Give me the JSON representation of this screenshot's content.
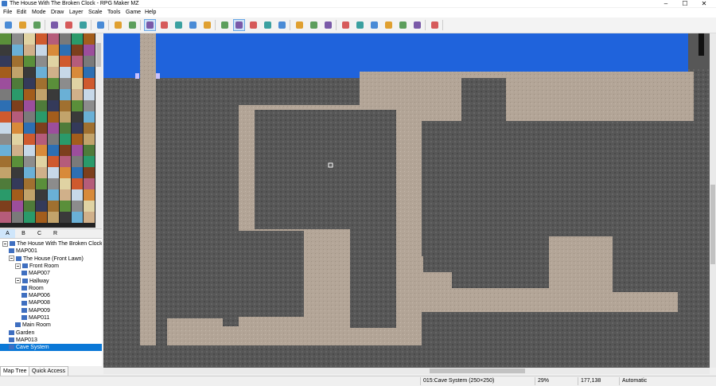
{
  "window": {
    "title": "The House With The Broken Clock - RPG Maker MZ",
    "minimize": "–",
    "maximize": "☐",
    "close": "✕"
  },
  "menu": [
    "File",
    "Edit",
    "Mode",
    "Draw",
    "Layer",
    "Scale",
    "Tools",
    "Game",
    "Help"
  ],
  "toolbar": {
    "icons": [
      "new-project-icon",
      "open-project-icon",
      "save-project-icon",
      "cut-icon",
      "copy-icon",
      "paste-icon",
      "undo-icon",
      "map-mode-icon",
      "event-mode-icon",
      "layer-auto-icon",
      "layer-1-icon",
      "layer-2-icon",
      "layer-3-icon",
      "layer-4-icon",
      "pencil-icon",
      "rectangle-icon",
      "ellipse-icon",
      "flood-fill-icon",
      "shadow-pen-icon",
      "zoom-in-icon",
      "zoom-out-icon",
      "zoom-actual-icon",
      "database-icon",
      "plugin-manager-icon",
      "sound-test-icon",
      "event-searcher-icon",
      "resource-manager-icon",
      "character-generator-icon",
      "playtest-icon"
    ],
    "active": [
      "layer-auto-icon",
      "rectangle-icon"
    ]
  },
  "palette_tabs": [
    "A",
    "B",
    "C",
    "R"
  ],
  "palette_active": "A",
  "map_tree": [
    {
      "label": "The House With The Broken Clock",
      "level": 0,
      "type": "project",
      "expand": true
    },
    {
      "label": "MAP001",
      "level": 1,
      "type": "map",
      "expand": false
    },
    {
      "label": "The House (Front Lawn)",
      "level": 1,
      "type": "map",
      "expand": true
    },
    {
      "label": "Front Room",
      "level": 2,
      "type": "map",
      "expand": true
    },
    {
      "label": "MAP007",
      "level": 3,
      "type": "map",
      "expand": false
    },
    {
      "label": "Hallway",
      "level": 2,
      "type": "map",
      "expand": true
    },
    {
      "label": "Room",
      "level": 3,
      "type": "map",
      "expand": false
    },
    {
      "label": "MAP006",
      "level": 3,
      "type": "map",
      "expand": false
    },
    {
      "label": "MAP008",
      "level": 3,
      "type": "map",
      "expand": false
    },
    {
      "label": "MAP009",
      "level": 3,
      "type": "map",
      "expand": false
    },
    {
      "label": "MAP011",
      "level": 3,
      "type": "map",
      "expand": false
    },
    {
      "label": "Main Room",
      "level": 2,
      "type": "map",
      "expand": false
    },
    {
      "label": "Garden",
      "level": 1,
      "type": "map",
      "expand": false
    },
    {
      "label": "MAP013",
      "level": 1,
      "type": "map",
      "expand": false
    },
    {
      "label": "Cave System",
      "level": 1,
      "type": "map",
      "expand": false,
      "selected": true
    }
  ],
  "tree_tabs": [
    "Map Tree",
    "Quick Access"
  ],
  "tree_tab_active": "Map Tree",
  "status": {
    "map": "015:Cave System (250×250)",
    "zoom": "29%",
    "coords": "177,138",
    "mode": "Automatic"
  },
  "colors": {
    "water": "#1f63dc",
    "rock": "#575757",
    "floor": "#b3a597",
    "selection": "#0a78d7"
  }
}
